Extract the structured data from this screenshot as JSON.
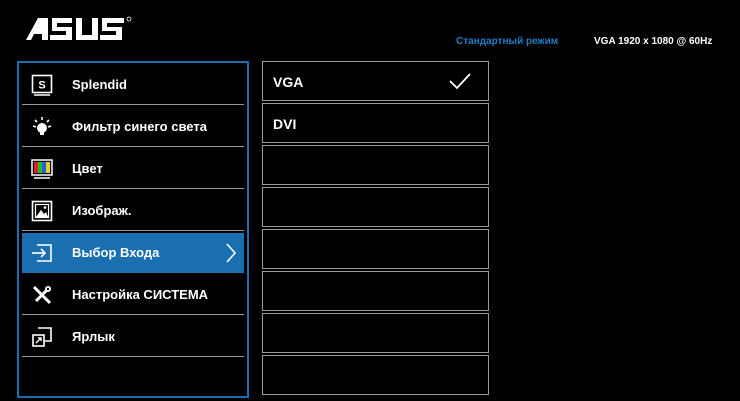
{
  "header": {
    "brand": "ASUS",
    "mode_label": "Стандартный режим",
    "resolution_label": "VGA 1920 x 1080 @ 60Hz"
  },
  "main_menu": {
    "items": [
      {
        "label": "Splendid",
        "icon": "splendid-icon"
      },
      {
        "label": "Фильтр синего света",
        "icon": "bluelight-icon"
      },
      {
        "label": "Цвет",
        "icon": "color-icon"
      },
      {
        "label": "Изображ.",
        "icon": "image-icon"
      },
      {
        "label": "Выбор Входа",
        "icon": "input-select-icon",
        "selected": true
      },
      {
        "label": "Настройка СИСТЕМА",
        "icon": "system-setup-icon"
      },
      {
        "label": "Ярлык",
        "icon": "shortcut-icon"
      }
    ]
  },
  "submenu": {
    "items": [
      {
        "label": "VGA",
        "checked": true
      },
      {
        "label": "DVI"
      },
      {
        "label": ""
      },
      {
        "label": ""
      },
      {
        "label": ""
      },
      {
        "label": ""
      },
      {
        "label": ""
      },
      {
        "label": ""
      }
    ]
  },
  "colors": {
    "accent": "#1a6fb0",
    "mode_text": "#1e7fc7",
    "background": "#000000"
  }
}
